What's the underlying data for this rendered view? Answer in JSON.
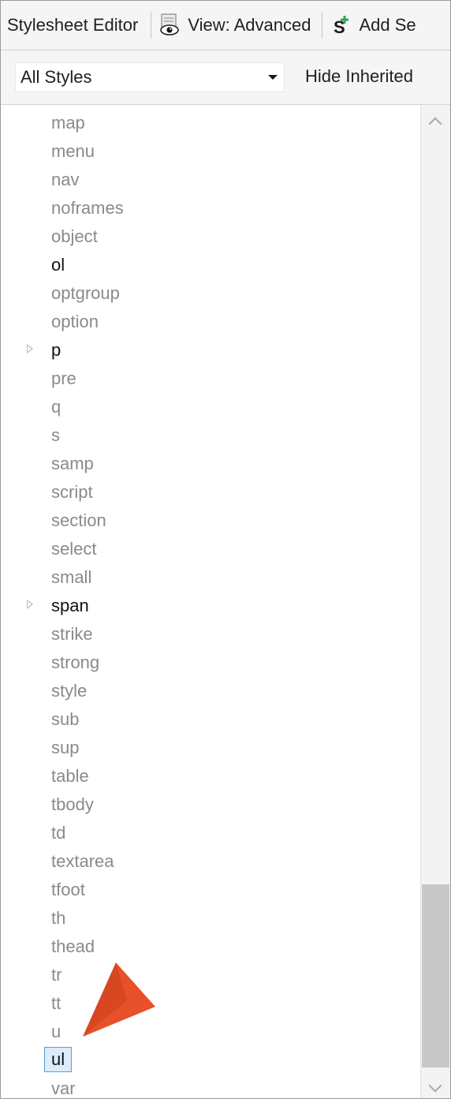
{
  "toolbar": {
    "title": "Stylesheet Editor",
    "view_button_label": "View: Advanced",
    "add_button_label": "Add Se",
    "view_icon": "eye-icon",
    "add_icon": "add-selector-icon"
  },
  "filter": {
    "selected_value": "All Styles",
    "hide_inherited_label": "Hide Inherited"
  },
  "list": {
    "items": [
      {
        "label": "map"
      },
      {
        "label": "menu"
      },
      {
        "label": "nav"
      },
      {
        "label": "noframes"
      },
      {
        "label": "object"
      },
      {
        "label": "ol"
      },
      {
        "label": "optgroup"
      },
      {
        "label": "option"
      },
      {
        "label": "p"
      },
      {
        "label": "pre"
      },
      {
        "label": "q"
      },
      {
        "label": "s"
      },
      {
        "label": "samp"
      },
      {
        "label": "script"
      },
      {
        "label": "section"
      },
      {
        "label": "select"
      },
      {
        "label": "small"
      },
      {
        "label": "span"
      },
      {
        "label": "strike"
      },
      {
        "label": "strong"
      },
      {
        "label": "style"
      },
      {
        "label": "sub"
      },
      {
        "label": "sup"
      },
      {
        "label": "table"
      },
      {
        "label": "tbody"
      },
      {
        "label": "td"
      },
      {
        "label": "textarea"
      },
      {
        "label": "tfoot"
      },
      {
        "label": "th"
      },
      {
        "label": "thead"
      },
      {
        "label": "tr"
      },
      {
        "label": "tt"
      },
      {
        "label": "u"
      },
      {
        "label": "ul"
      },
      {
        "label": "var"
      }
    ],
    "selected_label": "ul"
  },
  "colors": {
    "callout": "#e8502a",
    "selection_border": "#4fa3e0",
    "selection_fill": "#dcecfa",
    "inherited_text": "#8a8a8a",
    "defined_text": "#111111"
  }
}
